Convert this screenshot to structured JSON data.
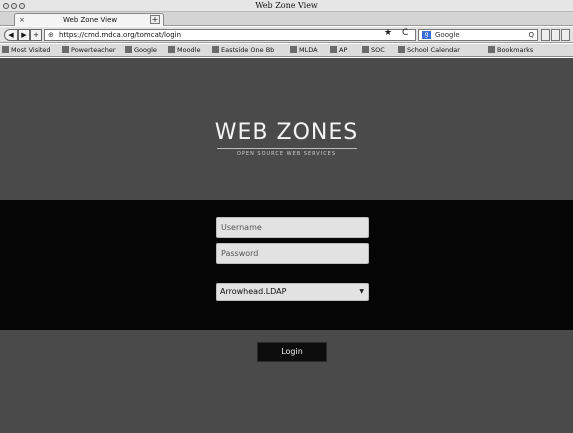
{
  "window": {
    "title": "Web Zone View"
  },
  "tab": {
    "label": "Web Zone View",
    "close_glyph": "×",
    "new_tab_glyph": "+"
  },
  "nav": {
    "back_glyph": "◀",
    "forward_glyph": "▶",
    "sep_glyph": "+",
    "url": "https://cmd.mdca.org/tomcat/login",
    "star_glyph": "★",
    "reload_glyph": "C",
    "search_placeholder": "Google",
    "search_engine_glyph": "g",
    "search_glyph": "Q"
  },
  "bookmarks": [
    "Most Visited",
    "Powerteacher",
    "Google",
    "Moodle",
    "Eastside One Bb",
    "MLDA",
    "AP",
    "SOC",
    "School Calendar",
    "Bookmarks"
  ],
  "page": {
    "logo": "WEB ZONES",
    "logo_subtitle": "OPEN SOURCE WEB SERVICES",
    "username_placeholder": "Username",
    "password_placeholder": "Password",
    "realm_selected": "Arrowhead.LDAP",
    "login_label": "Login"
  },
  "colors": {
    "page_background": "#4a4a4a",
    "form_band": "#050505",
    "field_background": "#e2e2e2",
    "button_background": "#0d0d0d"
  }
}
